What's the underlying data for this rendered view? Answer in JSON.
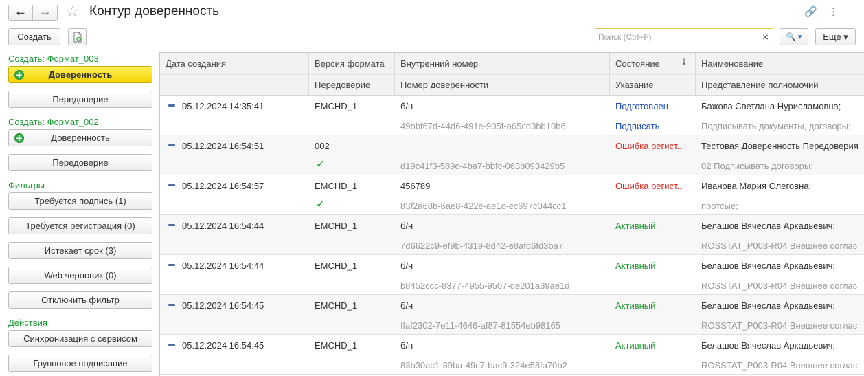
{
  "window": {
    "title": "Контур доверенность",
    "back_icon": "←",
    "forward_icon": "→",
    "star_icon": "☆",
    "link_icon": "🔗",
    "more_icon": "⋮"
  },
  "toolbar": {
    "create_label": "Создать",
    "search_placeholder": "Поиск (Ctrl+F)",
    "search_clear": "×",
    "search_button": "🔍 ▾",
    "more_label": "Еще ▾"
  },
  "sidebar": {
    "group_format_003": "Создать: Формат_003",
    "btn_power_003": "Доверенность",
    "btn_redelegation_003": "Передоверие",
    "group_format_002": "Создать: Формат_002",
    "btn_power_002": "Доверенность",
    "btn_redelegation_002": "Передоверие",
    "group_filters": "Фильтры",
    "filter_signature": "Требуется подпись (1)",
    "filter_registration": "Требуется регистрация (0)",
    "filter_expiring": "Истекает срок (3)",
    "filter_web_draft": "Web черновик (0)",
    "filter_disable": "Отключить фильтр",
    "group_actions": "Действия",
    "action_sync": "Синхронизация с сервисом",
    "action_group_sign": "Групповое подписание"
  },
  "table": {
    "headers": {
      "created": "Дата создания",
      "format_version": "Версия формата",
      "redelegation": "Передоверие",
      "internal_number": "Внутренний номер",
      "power_number": "Номер доверенности",
      "state": "Состояние",
      "instruction": "Указание",
      "name": "Наименование",
      "powers": "Представление полномочий",
      "sort_icon": "↓"
    },
    "rows": [
      {
        "date": "05.12.2024 14:35:41",
        "format": "EMCHD_1",
        "redeleg": "",
        "internal": "б/н",
        "guid": "49bbf67d-44d6-491e-905f-a65cd3bb10b6",
        "state": "Подготовлен",
        "instruction": "Подписать",
        "name": "Бажова Светлана Нурисламовна;",
        "powers": "Подписывать документы, договоры;"
      },
      {
        "date": "05.12.2024 16:54:51",
        "format": "002",
        "redeleg": "✓",
        "internal": "",
        "guid": "d19c41f3-589c-4ba7-bbfc-063b093429b5",
        "state": "Ошибка регист...",
        "instruction": "",
        "name": "Тестовая Доверенность Передоверия",
        "powers": "02 Подписывать договоры;"
      },
      {
        "date": "05.12.2024 16:54:57",
        "format": "EMCHD_1",
        "redeleg": "✓",
        "internal": "456789",
        "guid": "83f2a68b-6ae8-422e-ae1c-ec697c044cc1",
        "state": "Ошибка регист...",
        "instruction": "",
        "name": "Иванова Мария Олеговна;",
        "powers": "протсые;"
      },
      {
        "date": "05.12.2024 16:54:44",
        "format": "EMCHD_1",
        "redeleg": "",
        "internal": "б/н",
        "guid": "7d6622c9-ef9b-4319-8d42-e8afd6fd3ba7",
        "state": "Активный",
        "instruction": "",
        "name": "Белашов Вячеслав Аркадьевич;",
        "powers": "ROSSTAT_P003-R04 Внешнее соглас"
      },
      {
        "date": "05.12.2024 16:54:44",
        "format": "EMCHD_1",
        "redeleg": "",
        "internal": "б/н",
        "guid": "b8452ccc-8377-4955-9507-de201a89ae1d",
        "state": "Активный",
        "instruction": "",
        "name": "Белашов Вячеслав Аркадьевич;",
        "powers": "ROSSTAT_P003-R04 Внешнее соглас"
      },
      {
        "date": "05.12.2024 16:54:45",
        "format": "EMCHD_1",
        "redeleg": "",
        "internal": "б/н",
        "guid": "ffaf2302-7e11-4646-af87-81554eb98165",
        "state": "Активный",
        "instruction": "",
        "name": "Белашов Вячеслав Аркадьевич;",
        "powers": "ROSSTAT_P003-R04 Внешнее соглас"
      },
      {
        "date": "05.12.2024 16:54:45",
        "format": "EMCHD_1",
        "redeleg": "",
        "internal": "б/н",
        "guid": "83b30ac1-39ba-49c7-bac9-324e58fa70b2",
        "state": "Активный",
        "instruction": "",
        "name": "Белашов Вячеслав Аркадьевич;",
        "powers": "ROSSTAT_P003-R04 Внешнее соглас"
      }
    ]
  },
  "colors": {
    "state_Подготовлен": "#1f4fb8",
    "state_Ошибка регист...": "#e0261e",
    "state_Активный": "#1f9a2e",
    "instruction": "#1f4fb8",
    "group_label": "#1c9a33",
    "primary_button": "#f4d300"
  }
}
